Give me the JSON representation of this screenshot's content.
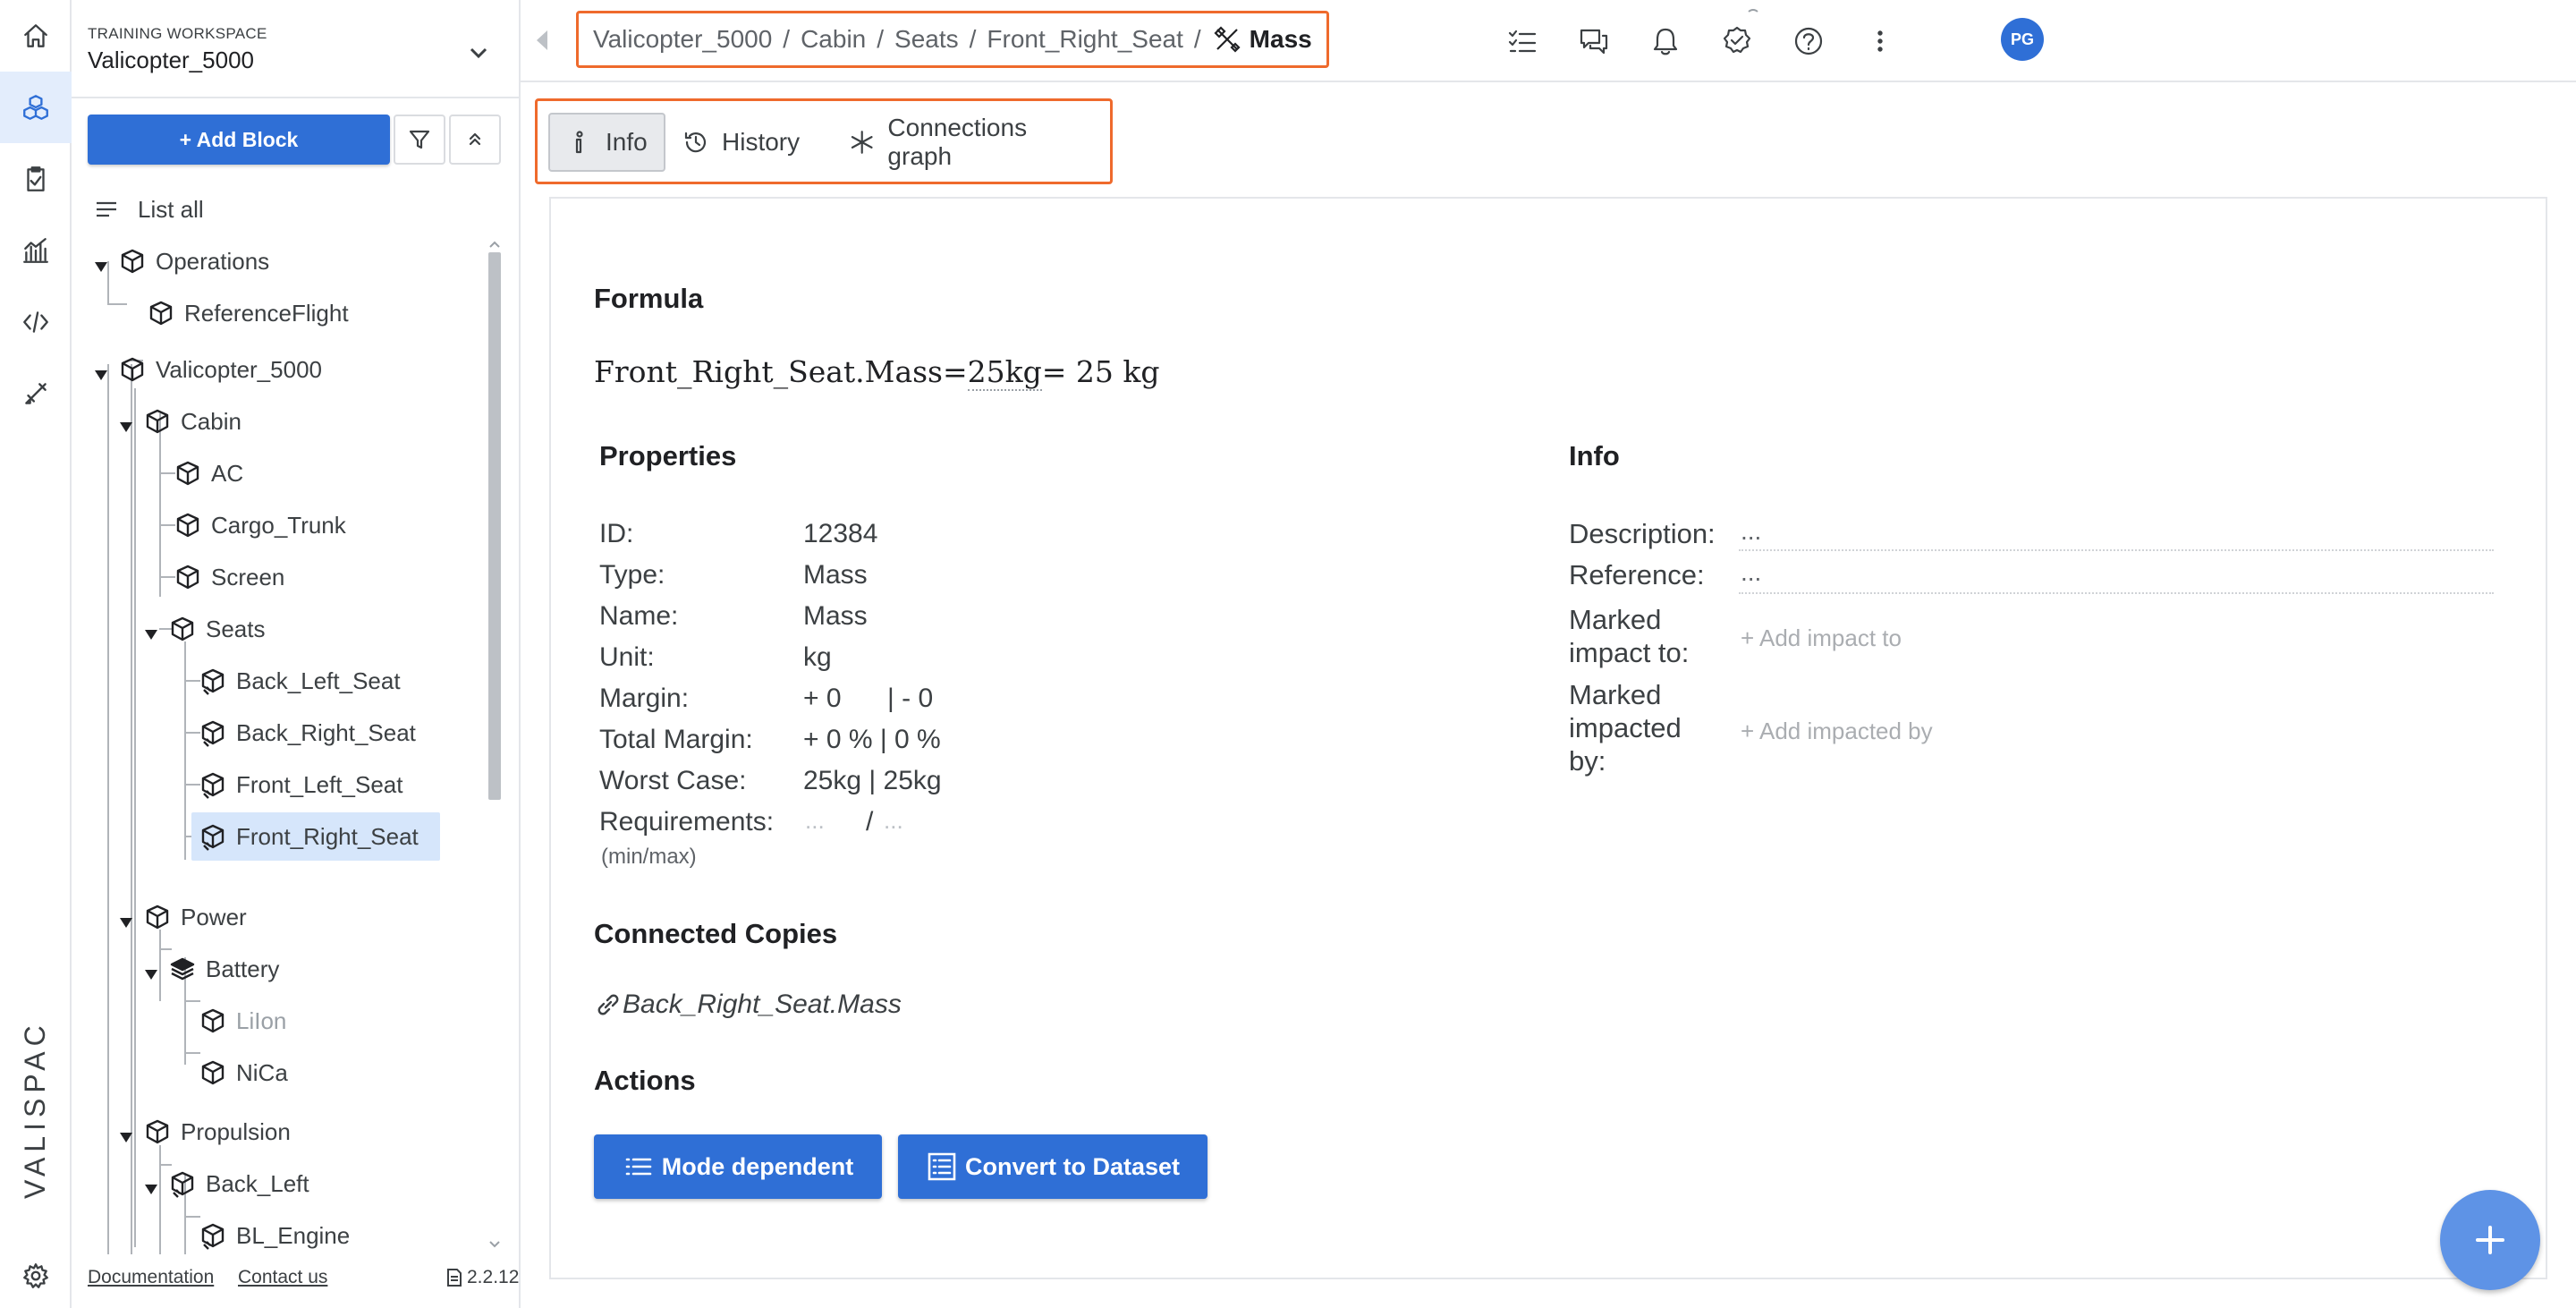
{
  "workspace": {
    "label": "TRAINING WORKSPACE",
    "name": "Valicopter_5000"
  },
  "sidebar": {
    "add_block_label": "+ Add Block",
    "list_all_label": "List all",
    "tree": [
      {
        "label": "Operations"
      },
      {
        "label": "ReferenceFlight"
      },
      {
        "label": "Valicopter_5000"
      },
      {
        "label": "Cabin"
      },
      {
        "label": "AC"
      },
      {
        "label": "Cargo_Trunk"
      },
      {
        "label": "Screen"
      },
      {
        "label": "Seats"
      },
      {
        "label": "Back_Left_Seat"
      },
      {
        "label": "Back_Right_Seat"
      },
      {
        "label": "Front_Left_Seat"
      },
      {
        "label": "Front_Right_Seat"
      },
      {
        "label": "Power"
      },
      {
        "label": "Battery"
      },
      {
        "label": "LiIon"
      },
      {
        "label": "NiCa"
      },
      {
        "label": "Propulsion"
      },
      {
        "label": "Back_Left"
      },
      {
        "label": "BL_Engine"
      }
    ],
    "footer": {
      "documentation": "Documentation",
      "contact": "Contact us",
      "version": "2.2.12"
    }
  },
  "rail": {
    "brand": "VALISPACE"
  },
  "breadcrumb": {
    "items": [
      "Valicopter_5000",
      "Cabin",
      "Seats",
      "Front_Right_Seat"
    ],
    "separator": "/",
    "current": "Mass"
  },
  "topbar": {
    "avatar_initials": "PG"
  },
  "tabs": [
    {
      "label": "Info",
      "icon": "info-icon"
    },
    {
      "label": "History",
      "icon": "history-icon"
    },
    {
      "label": "Connections graph",
      "icon": "graph-icon"
    }
  ],
  "formula": {
    "heading": "Formula",
    "lhs": "Front_Right_Seat.Mass",
    "eq1": "=",
    "expr": "25kg",
    "eq2": "=",
    "result": " 25 kg"
  },
  "properties": {
    "heading": "Properties",
    "id_label": "ID:",
    "id": "12384",
    "type_label": "Type:",
    "type": "Mass",
    "name_label": "Name:",
    "name": "Mass",
    "unit_label": "Unit:",
    "unit": "kg",
    "margin_label": "Margin:",
    "margin_plus": "+ 0",
    "margin_minus": "| - 0",
    "total_margin_label": "Total Margin:",
    "total_margin": "+ 0 % | 0 %",
    "worst_case_label": "Worst Case:",
    "worst_case": "25kg | 25kg",
    "requirements_label": "Requirements:",
    "requirements_sub": "(min/max)",
    "req_min": "...",
    "req_sep": "/",
    "req_max": "..."
  },
  "info": {
    "heading": "Info",
    "description_label": "Description:",
    "description": "...",
    "reference_label": "Reference:",
    "reference": "...",
    "impact_to_label_1": "Marked",
    "impact_to_label_2": "impact to:",
    "impact_to_add": "+ Add impact to",
    "impacted_by_label_1": "Marked",
    "impacted_by_label_2": "impacted",
    "impacted_by_label_3": "by:",
    "impacted_by_add": "+ Add impacted by"
  },
  "connected_copies": {
    "heading": "Connected Copies",
    "items": [
      "Back_Right_Seat.Mass"
    ]
  },
  "actions": {
    "heading": "Actions",
    "mode_dependent": "Mode dependent",
    "convert": "Convert to Dataset"
  },
  "colors": {
    "accent": "#2f6fd6",
    "highlight_border": "#ef6a2c",
    "selected_row": "#d6e6fb"
  }
}
